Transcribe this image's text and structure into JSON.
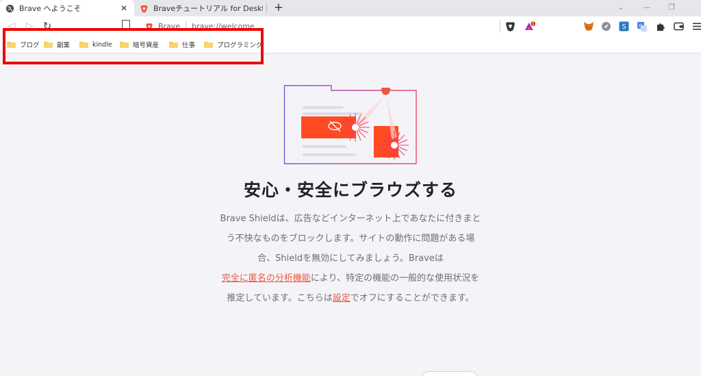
{
  "tabs": [
    {
      "title": "Brave へようこそ",
      "close": "✕"
    },
    {
      "title": "Braveチュートリアル for Desktop | Brave"
    }
  ],
  "new_tab": "+",
  "window_controls": [
    "⌄",
    "—",
    "❐"
  ],
  "url": {
    "site": "Brave",
    "address": "brave://welcome"
  },
  "brave_rewards_badge": "1",
  "bookmarks": [
    "ブログ",
    "副業",
    "kindle",
    "暗号資産",
    "仕事",
    "プログラミング"
  ],
  "headline": "安心・安全にブラウズする",
  "description": {
    "line1": "Brave Shieldは、広告などインターネット上であなたに付きまと",
    "line2": "う不快なものをブロックします。サイトの動作に問題がある場",
    "line3": "合、Shieldを無効にしてみましょう。Braveは",
    "link1": "完全に匿名の分析機能",
    "line4_rest": "により、特定の機能の一般的な使用状況を",
    "line5_start": "推定しています。こちらは",
    "link2": "設定",
    "line5_end": "でオフにすることができます。"
  },
  "icons": {
    "back": "back-arrow-icon",
    "forward": "forward-arrow-icon",
    "reload": "reload-icon",
    "bookmark_toggle": "bookmark-icon",
    "shields": "brave-shield-icon",
    "rewards": "brave-rewards-icon",
    "metamask": "metamask-fox-icon",
    "extensions": "puzzle-icon",
    "wallet": "wallet-icon",
    "menu": "hamburger-menu-icon"
  },
  "colors": {
    "accent": "#f0543e",
    "highlight": "#ee0000",
    "folder": "#f6c94b"
  }
}
